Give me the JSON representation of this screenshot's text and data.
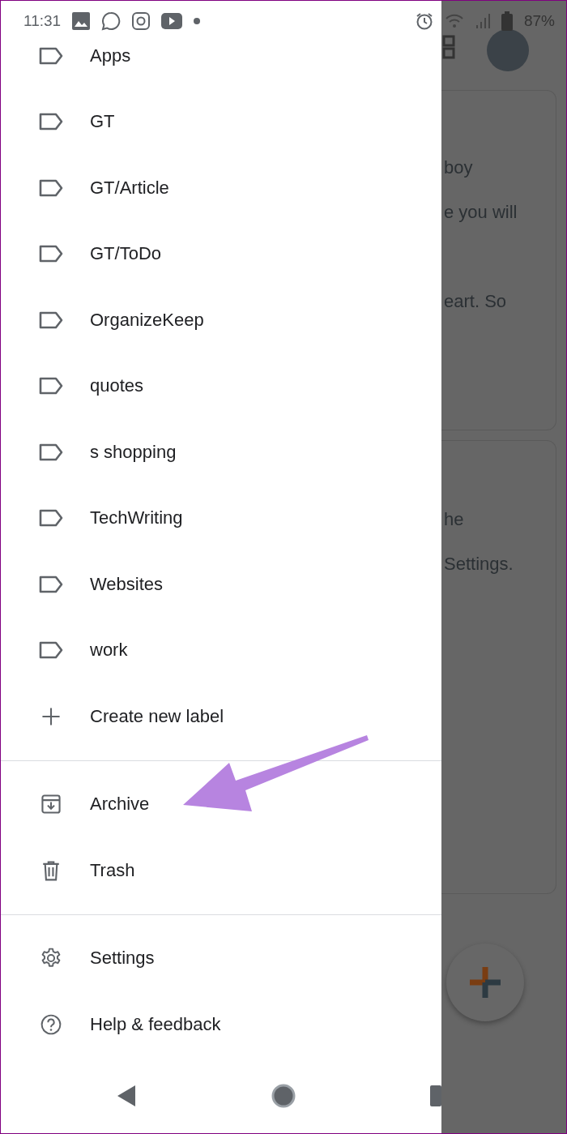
{
  "status_bar": {
    "time": "11:31",
    "battery": "87%"
  },
  "drawer": {
    "labels": [
      {
        "kind": "label",
        "text": "Apps"
      },
      {
        "kind": "label",
        "text": "GT"
      },
      {
        "kind": "label",
        "text": "GT/Article"
      },
      {
        "kind": "label",
        "text": "GT/ToDo"
      },
      {
        "kind": "label",
        "text": "OrganizeKeep"
      },
      {
        "kind": "label",
        "text": "quotes"
      },
      {
        "kind": "label",
        "text": "s shopping"
      },
      {
        "kind": "label",
        "text": "TechWriting"
      },
      {
        "kind": "label",
        "text": "Websites"
      },
      {
        "kind": "label",
        "text": "work"
      },
      {
        "kind": "create",
        "text": "Create new label"
      }
    ],
    "folders": [
      {
        "kind": "archive",
        "text": "Archive"
      },
      {
        "kind": "trash",
        "text": "Trash"
      }
    ],
    "footer": [
      {
        "kind": "settings",
        "text": "Settings"
      },
      {
        "kind": "help",
        "text": "Help & feedback"
      }
    ]
  },
  "notes": [
    {
      "lines": [
        "boy",
        "e you will",
        "eart. So"
      ]
    },
    {
      "lines": [
        "he",
        "Settings."
      ]
    }
  ]
}
